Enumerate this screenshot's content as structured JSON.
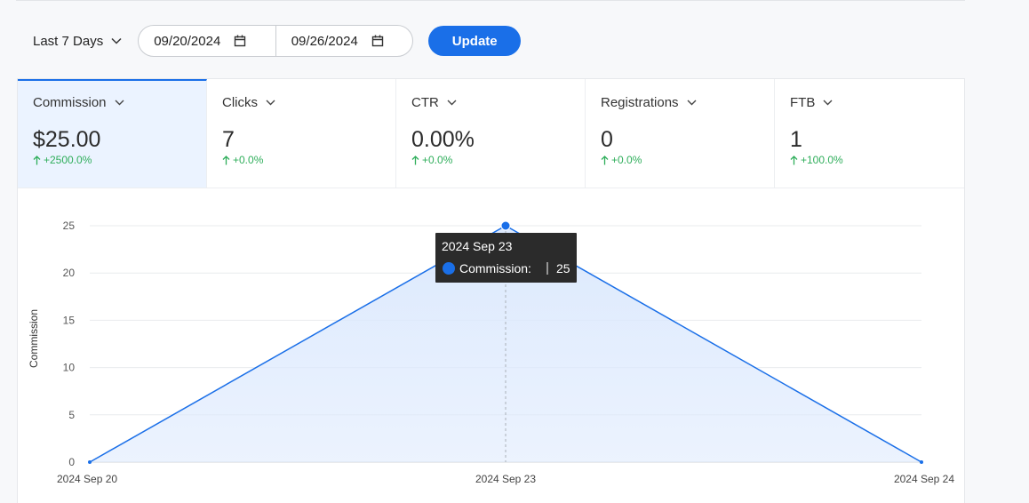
{
  "toolbar": {
    "range_label": "Last 7 Days",
    "start_date": "09/20/2024",
    "end_date": "09/26/2024",
    "update_label": "Update"
  },
  "metrics": [
    {
      "label": "Commission",
      "value": "$25.00",
      "delta": "+2500.0%"
    },
    {
      "label": "Clicks",
      "value": "7",
      "delta": "+0.0%"
    },
    {
      "label": "CTR",
      "value": "0.00%",
      "delta": "+0.0%"
    },
    {
      "label": "Registrations",
      "value": "0",
      "delta": "+0.0%"
    },
    {
      "label": "FTB",
      "value": "1",
      "delta": "+100.0%"
    }
  ],
  "colors": {
    "accent": "#1a6fe8",
    "positive": "#2fae5b",
    "area": "#dce9fd"
  },
  "tooltip": {
    "title": "2024 Sep 23",
    "series": "Commission:",
    "value": "25"
  },
  "chart_data": {
    "type": "area",
    "x": [
      "2024 Sep 20",
      "2024 Sep 23",
      "2024 Sep 24"
    ],
    "series": [
      {
        "name": "Commission",
        "values": [
          0,
          25,
          0
        ]
      }
    ],
    "ylabel": "Commission",
    "yticks": [
      0,
      5,
      10,
      15,
      20,
      25
    ],
    "ylim": [
      0,
      25
    ],
    "grid": true
  }
}
